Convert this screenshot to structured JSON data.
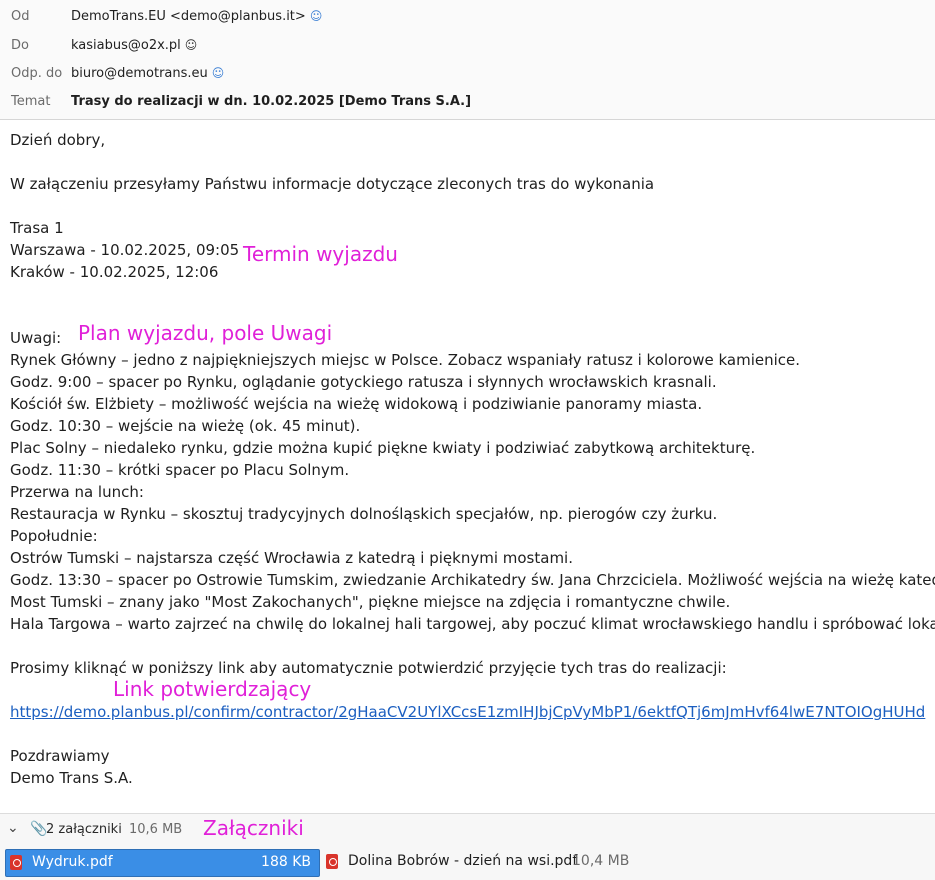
{
  "header": {
    "from_label": "Od",
    "from_value": "DemoTrans.EU <demo@planbus.it>",
    "to_label": "Do",
    "to_value": "kasiabus@o2x.pl",
    "reply_label": "Odp. do",
    "reply_value": "biuro@demotrans.eu",
    "subject_label": "Temat",
    "subject_value": "Trasy do realizacji w dn. 10.02.2025 [Demo Trans S.A.]"
  },
  "body": {
    "greeting": "Dzień dobry,",
    "intro": "W załączeniu przesyłamy Państwu informacje dotyczące zleconych tras do wykonania",
    "route_title": "Trasa 1",
    "departure": "Warszawa - 10.02.2025, 09:05",
    "arrival": "Kraków - 10.02.2025, 12:06",
    "remarks_label": "Uwagi:",
    "remarks": [
      "Rynek Główny – jedno z najpiękniejszych miejsc w Polsce. Zobacz wspaniały ratusz i kolorowe kamienice.",
      "Godz. 9:00 – spacer po Rynku, oglądanie gotyckiego ratusza i słynnych wrocławskich krasnali.",
      "Kościół św. Elżbiety – możliwość wejścia na wieżę widokową i podziwianie panoramy miasta.",
      "Godz. 10:30 – wejście na wieżę (ok. 45 minut).",
      "Plac Solny – niedaleko rynku, gdzie można kupić piękne kwiaty i podziwiać zabytkową architekturę.",
      "Godz. 11:30 – krótki spacer po Placu Solnym.",
      "Przerwa na lunch:",
      "Restauracja w Rynku – skosztuj tradycyjnych dolnośląskich specjałów, np. pierogów czy żurku.",
      "Popołudnie:",
      "Ostrów Tumski – najstarsza część Wrocławia z katedrą i pięknymi mostami.",
      "Godz. 13:30 – spacer po Ostrowie Tumskim, zwiedzanie Archikatedry św. Jana Chrzciciela. Możliwość wejścia na wieżę katedr",
      "Most Tumski – znany jako \"Most Zakochanych\", piękne miejsce na zdjęcia i romantyczne chwile.",
      "Hala Targowa – warto zajrzeć na chwilę do lokalnej hali targowej, aby poczuć klimat wrocławskiego handlu i spróbować loka"
    ],
    "confirm_text": "Prosimy kliknąć w poniższy link aby automatycznie potwierdzić przyjęcie tych tras do realizacji:",
    "confirm_link": "https://demo.planbus.pl/confirm/contractor/2gHaaCV2UYlXCcsE1zmIHJbjCpVyMbP1/6ektfQTj6mJmHvf64lwE7NTOIOgHUHd",
    "closing": "Pozdrawiamy",
    "signature": "Demo Trans S.A."
  },
  "annotations": {
    "departure_term": "Termin wyjazdu",
    "plan_remarks": "Plan wyjazdu, pole Uwagi",
    "confirm_link": "Link potwierdzający",
    "attachments": "Załączniki"
  },
  "attachments": {
    "count_label": "2 załączniki",
    "total_size": "10,6 MB",
    "items": [
      {
        "name": "Wydruk.pdf",
        "size": "188 KB"
      },
      {
        "name": "Dolina Bobrów - dzień na wsi.pdf",
        "size": "10,4 MB"
      }
    ]
  },
  "icons": {
    "from": "contact-icon",
    "to": "contact-icon",
    "reply": "contact-icon",
    "attachment_toggle": "chevron-down-icon",
    "attachment": "paperclip-icon",
    "pdf": "pdf-icon"
  },
  "colors": {
    "annotation": "#e020d8",
    "link": "#1c5fc0",
    "selected_attachment": "#3a8ee6",
    "pdf_icon": "#d9342b"
  }
}
